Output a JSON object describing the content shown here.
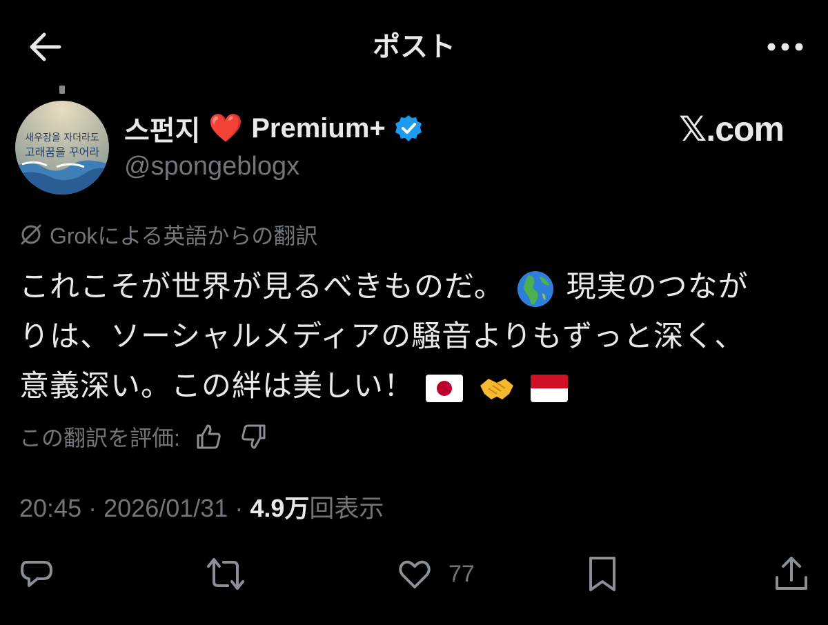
{
  "header": {
    "title": "ポスト",
    "back_icon": "arrow-left-icon",
    "more_icon": "more-horizontal-icon"
  },
  "author": {
    "display_name": "스펀지",
    "heart": "❤️",
    "badge_text": "Premium+",
    "handle": "@spongeblogx",
    "watermark": "𝕏.com",
    "avatar_lines": [
      "새우잠을 자더라도",
      "고래꿈을 꾸어라"
    ]
  },
  "translation": {
    "label": "Grokによる英語からの翻訳"
  },
  "tweet": {
    "line1": "これこそが世界が見るべきものだ。",
    "line1b": "現実のつなが",
    "line2": "りは、ソーシャルメディアの騒音よりもずっと深く、",
    "line3": "意義深い。この絆は美しい！"
  },
  "rating": {
    "label": "この翻訳を評価:"
  },
  "meta": {
    "time": "20:45",
    "sep": "·",
    "date": "2026/01/31",
    "views_count": "4.9万",
    "views_label": "回表示"
  },
  "actions": {
    "like_count": "77"
  },
  "colors": {
    "background": "#000000",
    "text": "#e7e9ea",
    "muted": "#71767b",
    "verified": "#1d9bf0"
  }
}
